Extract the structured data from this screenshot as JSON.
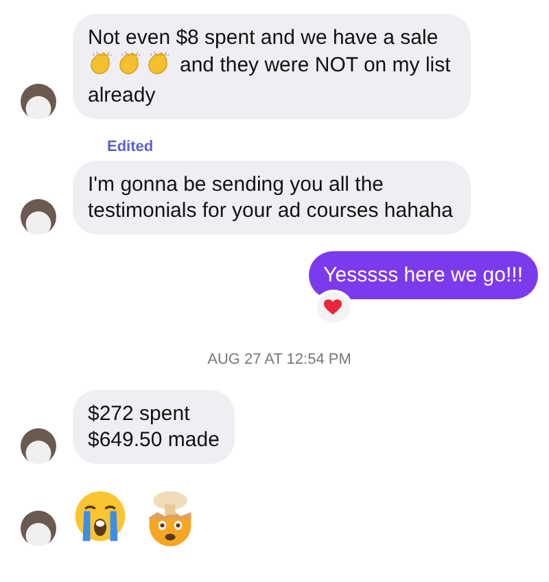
{
  "messages": [
    {
      "kind": "text",
      "outgoing": false,
      "avatar": true,
      "parts": [
        {
          "kind": "text",
          "text": "Not even $8 spent and we have a sale"
        },
        {
          "kind": "clap"
        },
        {
          "kind": "clap"
        },
        {
          "kind": "clap"
        },
        {
          "kind": "text",
          "text": "and they were NOT on my list"
        },
        {
          "kind": "text",
          "text": "already"
        }
      ]
    },
    {
      "kind": "edited",
      "text": "Edited"
    },
    {
      "kind": "text",
      "outgoing": false,
      "avatar": true,
      "parts": [
        {
          "kind": "text",
          "text": "I'm gonna be sending you all the testimonials for your ad courses hahaha"
        }
      ]
    },
    {
      "kind": "text",
      "outgoing": true,
      "reaction": {
        "kind": "heart"
      },
      "parts": [
        {
          "kind": "text",
          "text": "Yesssss here we go!!!"
        }
      ]
    },
    {
      "kind": "timestamp",
      "text": "AUG 27 AT 12:54 PM"
    },
    {
      "kind": "lines",
      "outgoing": false,
      "avatar": true,
      "lines": [
        "$272 spent",
        "$649.50 made"
      ]
    },
    {
      "kind": "emoji",
      "outgoing": false,
      "avatar": true,
      "emojis": [
        {
          "kind": "crying"
        },
        {
          "kind": "exploding"
        }
      ]
    }
  ]
}
